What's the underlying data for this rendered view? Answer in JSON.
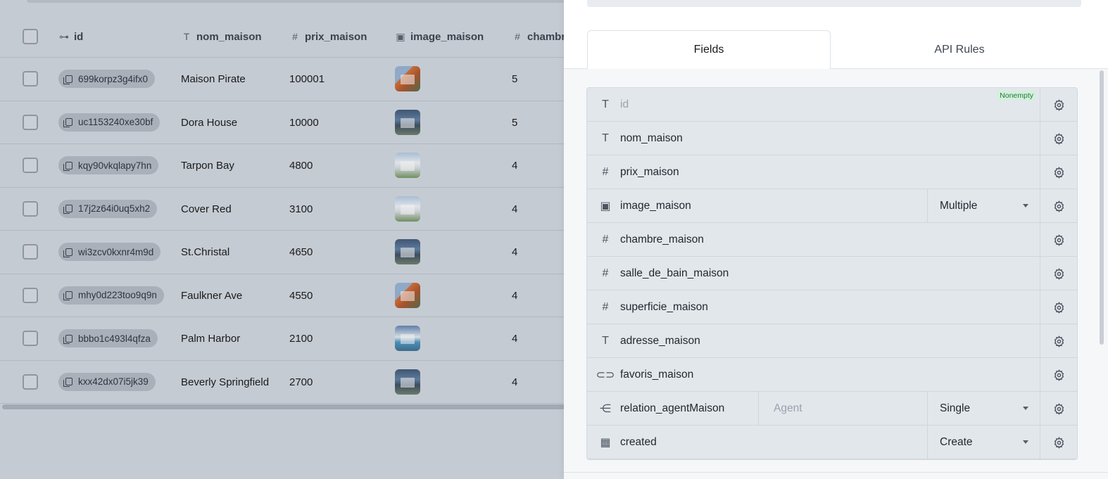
{
  "table": {
    "columns": [
      {
        "icon": "key-icon",
        "glyph": "⊶",
        "label": "id"
      },
      {
        "icon": "text-icon",
        "glyph": "T",
        "label": "nom_maison"
      },
      {
        "icon": "number-icon",
        "glyph": "#",
        "label": "prix_maison"
      },
      {
        "icon": "image-icon",
        "glyph": "▣",
        "label": "image_maison"
      },
      {
        "icon": "number-icon",
        "glyph": "#",
        "label": "chambr"
      }
    ],
    "rows": [
      {
        "id": "699korpz3g4ifx0",
        "nom": "Maison Pirate",
        "prix": "100001",
        "chambre": "5",
        "thumb": "orange"
      },
      {
        "id": "uc1153240xe30bf",
        "nom": "Dora House",
        "prix": "10000",
        "chambre": "5",
        "thumb": "dark"
      },
      {
        "id": "kqy90vkqlapy7hn",
        "nom": "Tarpon Bay",
        "prix": "4800",
        "chambre": "4",
        "thumb": "white"
      },
      {
        "id": "17j2z64i0uq5xh2",
        "nom": "Cover Red",
        "prix": "3100",
        "chambre": "4",
        "thumb": "white"
      },
      {
        "id": "wi3zcv0kxnr4m9d",
        "nom": "St.Christal",
        "prix": "4650",
        "chambre": "4",
        "thumb": "dark"
      },
      {
        "id": "mhy0d223too9q9n",
        "nom": "Faulkner Ave",
        "prix": "4550",
        "chambre": "4",
        "thumb": "orange"
      },
      {
        "id": "bbbo1c493l4qfza",
        "nom": "Palm Harbor",
        "prix": "2100",
        "chambre": "4",
        "thumb": "pool"
      },
      {
        "id": "kxx42dx07i5jk39",
        "nom": "Beverly Springfield",
        "prix": "2700",
        "chambre": "4",
        "thumb": "dark"
      }
    ]
  },
  "panel": {
    "tabs": {
      "fields": "Fields",
      "api_rules": "API Rules"
    },
    "fields": [
      {
        "icon": "text-icon",
        "glyph": "T",
        "name": "id",
        "muted": true,
        "badge": "Nonempty"
      },
      {
        "icon": "text-icon",
        "glyph": "T",
        "name": "nom_maison"
      },
      {
        "icon": "number-icon",
        "glyph": "#",
        "name": "prix_maison"
      },
      {
        "icon": "image-icon",
        "glyph": "▣",
        "name": "image_maison",
        "select": "Multiple"
      },
      {
        "icon": "number-icon",
        "glyph": "#",
        "name": "chambre_maison"
      },
      {
        "icon": "number-icon",
        "glyph": "#",
        "name": "salle_de_bain_maison"
      },
      {
        "icon": "number-icon",
        "glyph": "#",
        "name": "superficie_maison"
      },
      {
        "icon": "text-icon",
        "glyph": "T",
        "name": "adresse_maison"
      },
      {
        "icon": "toggle-icon",
        "glyph": "⊂⊃",
        "name": "favoris_maison"
      },
      {
        "icon": "relation-icon",
        "glyph": "⋲",
        "name": "relation_agentMaison",
        "relation": "Agent",
        "select": "Single"
      },
      {
        "icon": "calendar-icon",
        "glyph": "▦",
        "name": "created",
        "select": "Create"
      }
    ]
  }
}
